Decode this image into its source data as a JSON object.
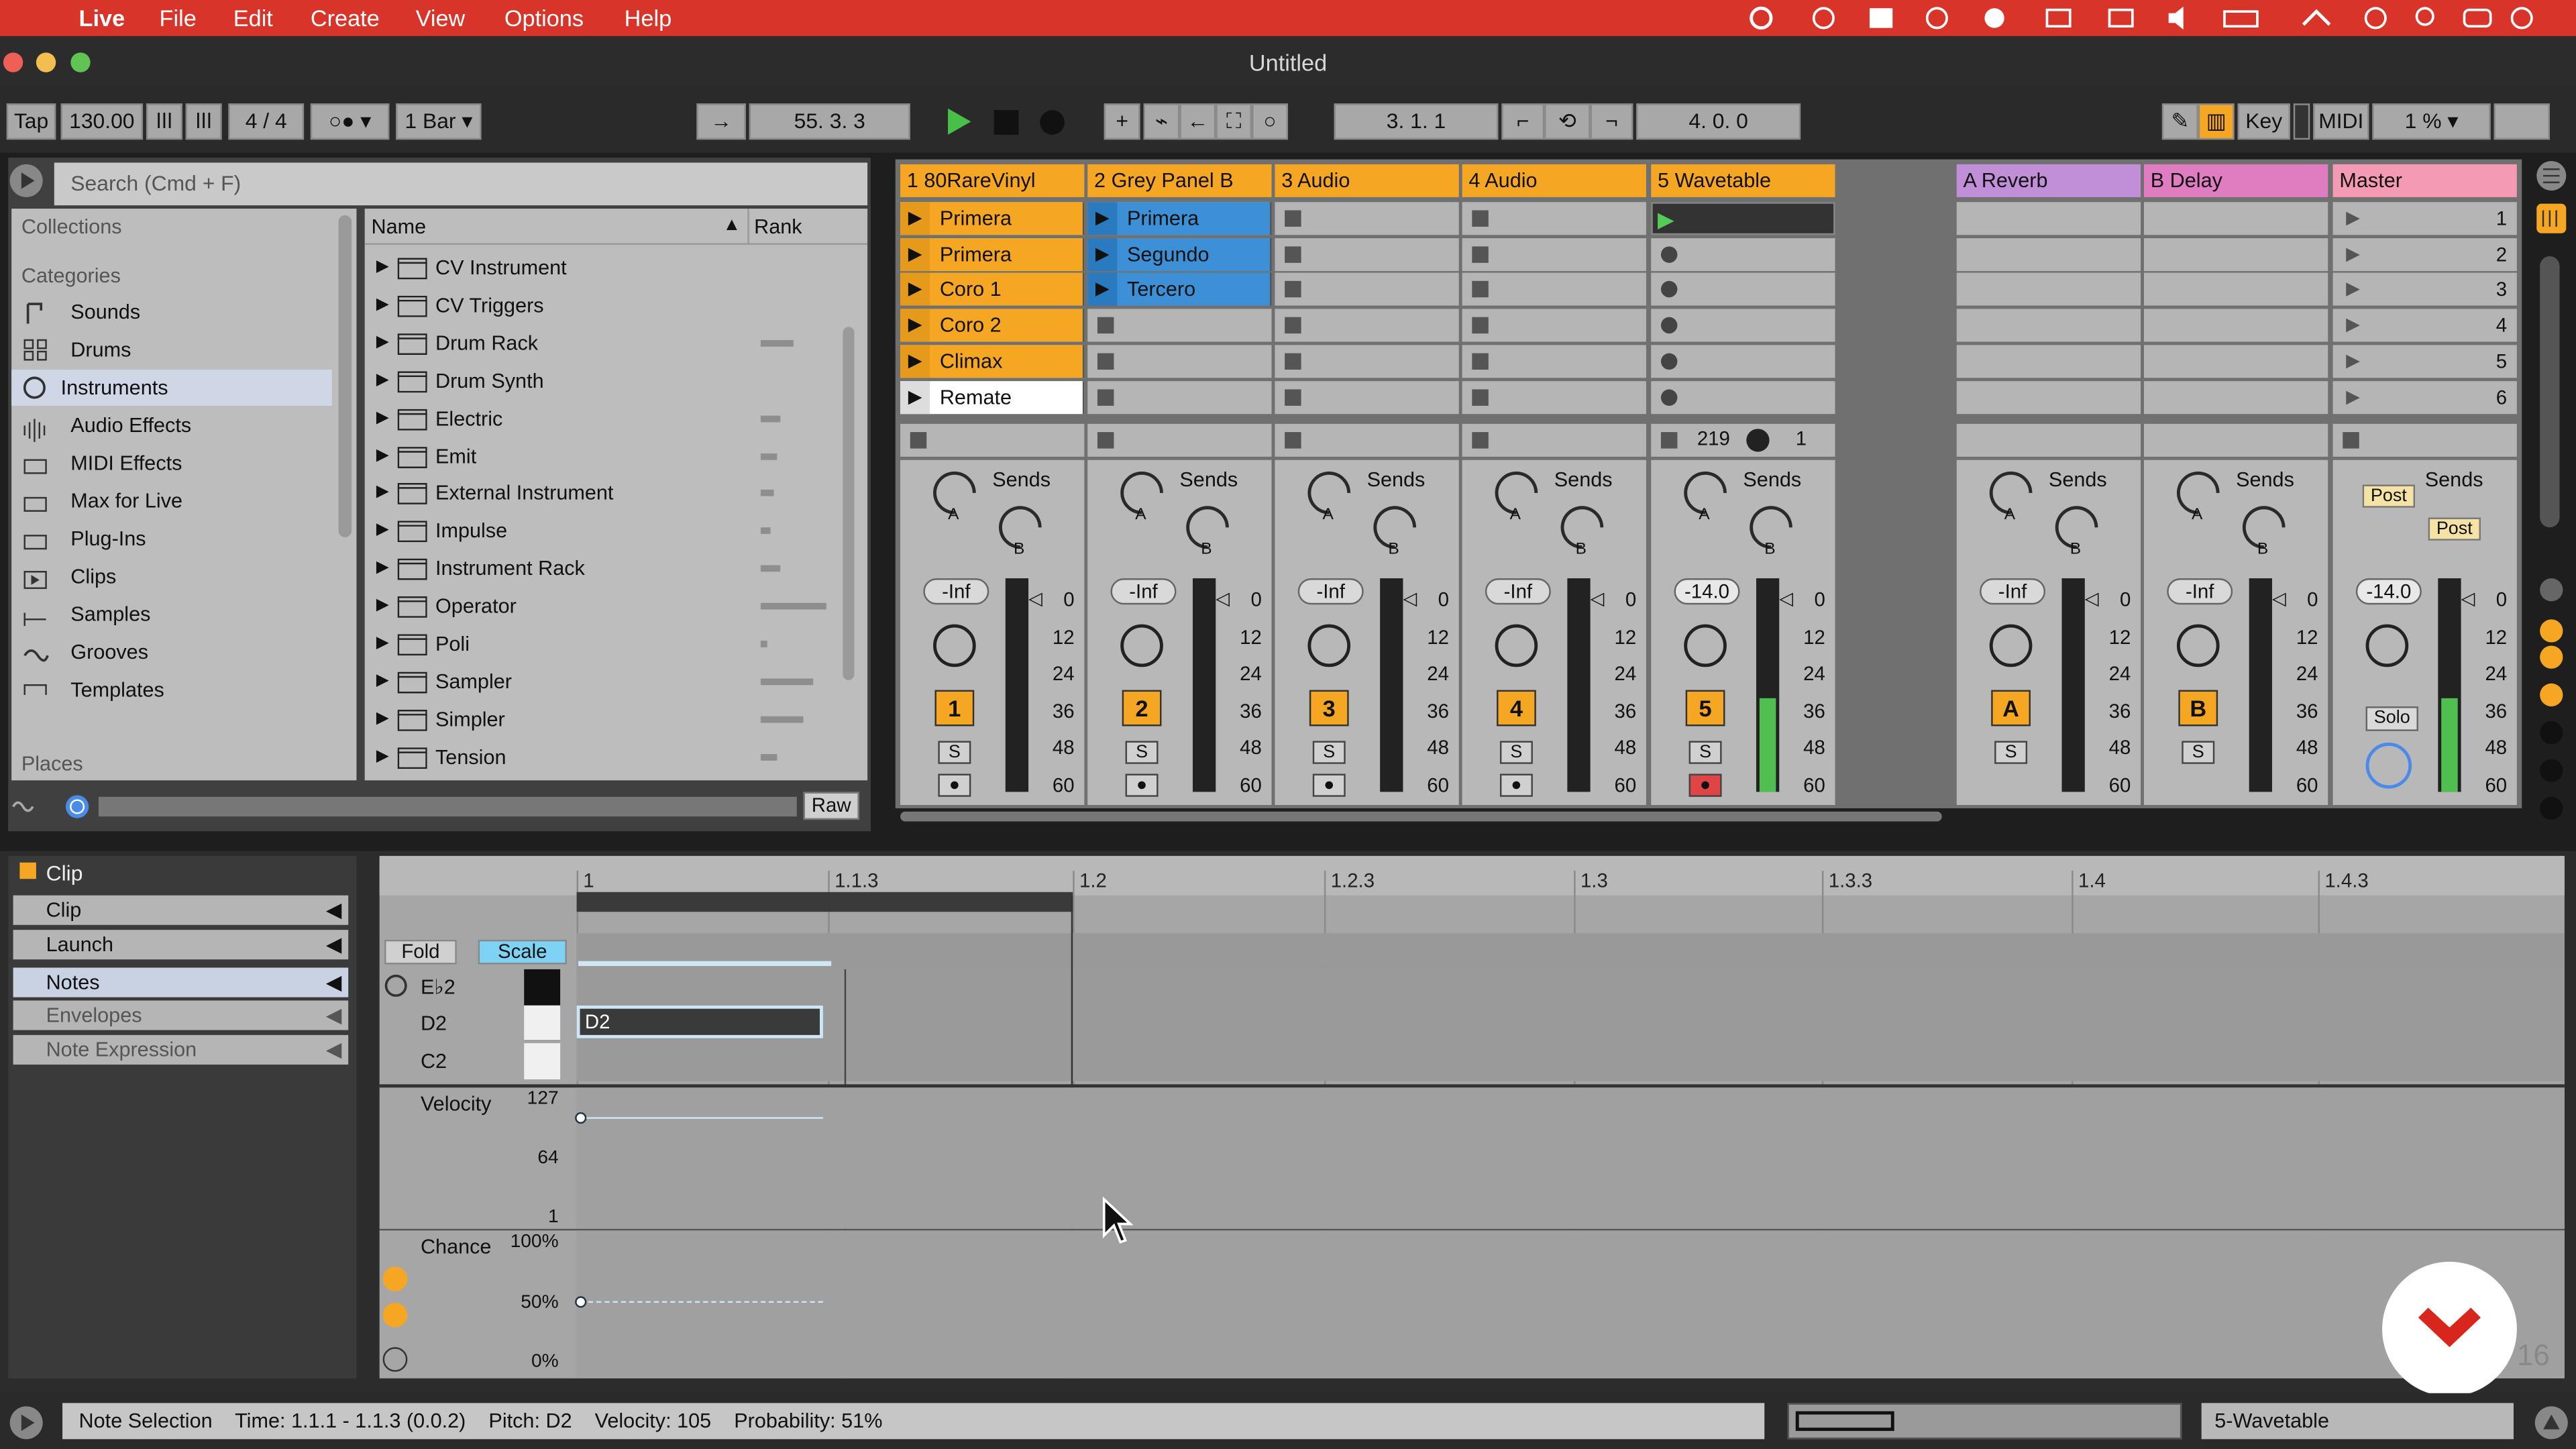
{
  "menu": {
    "app": "Live",
    "items": [
      "File",
      "Edit",
      "Create",
      "View",
      "Options",
      "Help"
    ]
  },
  "window": {
    "title": "Untitled"
  },
  "control": {
    "tap": "Tap",
    "tempo": "130.00",
    "signature": "4 / 4",
    "quantize": "1 Bar",
    "arrangement_pos": "55.   3.   3",
    "loop_start": "3.   1.   1",
    "loop_length": "4.   0.   0",
    "key": "Key",
    "midi": "MIDI",
    "cpu": "1 %"
  },
  "browser": {
    "search_placeholder": "Search (Cmd + F)",
    "collections": "Collections",
    "categories": "Categories",
    "places": "Places",
    "categories_items": [
      "Sounds",
      "Drums",
      "Instruments",
      "Audio Effects",
      "MIDI Effects",
      "Max for Live",
      "Plug-Ins",
      "Clips",
      "Samples",
      "Grooves",
      "Templates"
    ],
    "col_name": "Name",
    "col_rank": "Rank",
    "items": [
      "CV Instrument",
      "CV Triggers",
      "Drum Rack",
      "Drum Synth",
      "Electric",
      "Emit",
      "External Instrument",
      "Impulse",
      "Instrument Rack",
      "Operator",
      "Poli",
      "Sampler",
      "Simpler",
      "Tension"
    ],
    "raw": "Raw"
  },
  "tracks": [
    {
      "name": "1 80RareVinyl",
      "color": "#f5a623",
      "clips": [
        "Primera",
        "Primera",
        "Coro 1",
        "Coro 2",
        "Climax",
        "Remate"
      ],
      "vol": "-Inf",
      "num": "1"
    },
    {
      "name": "2 Grey Panel B",
      "color": "#f5a623",
      "clips": [
        "Primera",
        "Segundo",
        "Tercero"
      ],
      "vol": "-Inf",
      "num": "2"
    },
    {
      "name": "3 Audio",
      "color": "#f5a623",
      "vol": "-Inf",
      "num": "3"
    },
    {
      "name": "4 Audio",
      "color": "#f5a623",
      "vol": "-Inf",
      "num": "4"
    },
    {
      "name": "5 Wavetable",
      "color": "#f5a623",
      "vol": "-14.0",
      "num": "5",
      "device": "219",
      "device_val": "1"
    },
    {
      "name": "A Reverb",
      "color": "#c08fd8",
      "vol": "-Inf",
      "num": "A"
    },
    {
      "name": "B Delay",
      "color": "#e07cc0",
      "vol": "-Inf",
      "num": "B"
    },
    {
      "name": "Master",
      "color": "#f59ab4",
      "vol": "-14.0",
      "num": "Solo"
    }
  ],
  "scenes": [
    "1",
    "2",
    "3",
    "4",
    "5",
    "6"
  ],
  "mixer": {
    "sends": "Sends",
    "a": "A",
    "b": "B",
    "s": "S",
    "post": "Post",
    "scale": [
      "0",
      "12",
      "24",
      "36",
      "48",
      "60"
    ]
  },
  "clipview": {
    "header": "Clip",
    "tabs": [
      "Clip",
      "Launch",
      "Notes",
      "Envelopes",
      "Note Expression"
    ],
    "fold": "Fold",
    "scale": "Scale",
    "ruler": [
      "1",
      "1.1.3",
      "1.2",
      "1.2.3",
      "1.3",
      "1.3.3",
      "1.4",
      "1.4.3"
    ],
    "keys": [
      "E♭2",
      "D2",
      "C2"
    ],
    "note": "D2",
    "velocity": "Velocity",
    "vel_ticks": [
      "127",
      "64",
      "1"
    ],
    "chance": "Chance",
    "chance_ticks": [
      "100%",
      "50%",
      "0%"
    ],
    "page_num": "16"
  },
  "status": {
    "text": "Note Selection    Time: 1.1.1 - 1.1.3 (0.0.2)    Pitch: D2    Velocity: 105    Probability: 51%",
    "track": "5-Wavetable"
  }
}
